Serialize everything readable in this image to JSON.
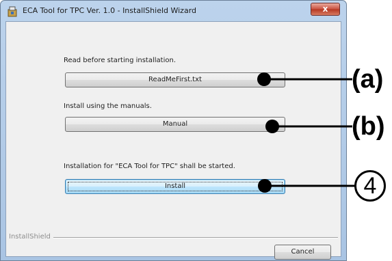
{
  "window": {
    "title": "ECA Tool for TPC Ver. 1.0 - InstallShield Wizard",
    "close_glyph": "x"
  },
  "sections": [
    {
      "label": "Read before starting installation.",
      "button": "ReadMeFirst.txt"
    },
    {
      "label": "Install using the manuals.",
      "button": "Manual"
    },
    {
      "label": "Installation for \"ECA Tool for TPC\" shall be started.",
      "button": "Install"
    }
  ],
  "footer": {
    "brand": "InstallShield",
    "cancel_label": "Cancel"
  },
  "callouts": {
    "a": "(a)",
    "b": "(b)",
    "c": "4"
  }
}
